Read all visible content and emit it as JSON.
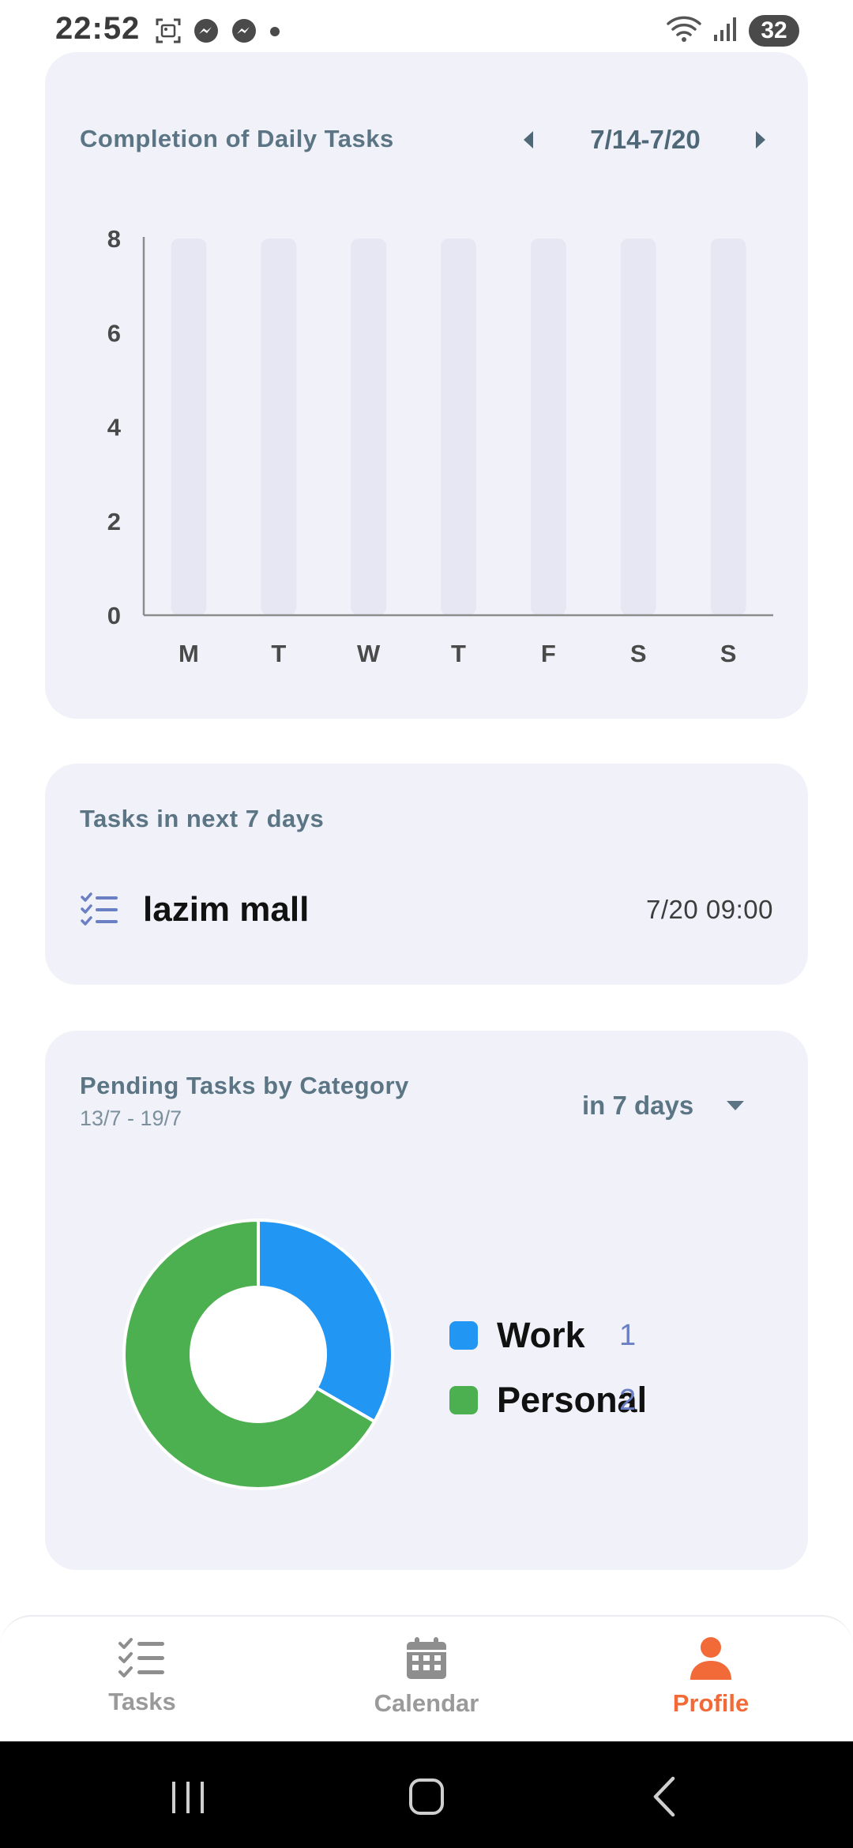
{
  "status_bar": {
    "time": "22:52",
    "battery": "32",
    "icons": [
      "screenshot-icon",
      "messenger-icon",
      "messenger-icon",
      "dot-icon",
      "wifi-icon",
      "signal-icon"
    ]
  },
  "completion_card": {
    "title": "Completion of Daily Tasks",
    "week_range": "7/14-7/20",
    "prev_icon": "caret-left-icon",
    "next_icon": "caret-right-icon"
  },
  "chart_data": {
    "type": "bar",
    "categories": [
      "M",
      "T",
      "W",
      "T",
      "F",
      "S",
      "S"
    ],
    "values": [
      0,
      0,
      0,
      0,
      0,
      0,
      0
    ],
    "capacity": 8,
    "ylim": [
      0,
      8
    ],
    "yticks": [
      0,
      2,
      4,
      6,
      8
    ],
    "title": "Completion of Daily Tasks",
    "xlabel": "",
    "ylabel": "",
    "grid": false,
    "colors": {
      "track": "#e6e7f3",
      "axis": "#8c8c8c",
      "tick_text": "#4a4a4a"
    }
  },
  "upcoming_card": {
    "title": "Tasks in next 7 days",
    "tasks": [
      {
        "icon": "checklist-icon",
        "name": "lazim mall",
        "datetime": "7/20 09:00"
      }
    ]
  },
  "pending_card": {
    "title": "Pending Tasks by Category",
    "subtitle": "13/7 - 19/7",
    "range_select": {
      "value": "in 7 days",
      "icon": "dropdown-arrow-icon"
    }
  },
  "pending_chart_data": {
    "type": "pie",
    "donut": true,
    "categories": [
      "Work",
      "Personal"
    ],
    "values": [
      1,
      2
    ],
    "colors": [
      "#2196f3",
      "#4caf50"
    ]
  },
  "legend": [
    {
      "label": "Work",
      "count": "1",
      "color": "#2196f3"
    },
    {
      "label": "Personal",
      "count": "2",
      "color": "#4caf50"
    }
  ],
  "bottom_nav": {
    "items": [
      {
        "label": "Tasks",
        "icon": "checklist-icon",
        "active": false
      },
      {
        "label": "Calendar",
        "icon": "calendar-icon",
        "active": false
      },
      {
        "label": "Profile",
        "icon": "person-icon",
        "active": true
      }
    ],
    "active_color": "#f26a38",
    "inactive_color": "#9a9a9a"
  },
  "system_nav": {
    "icons": [
      "recents-icon",
      "home-icon",
      "back-icon"
    ]
  }
}
